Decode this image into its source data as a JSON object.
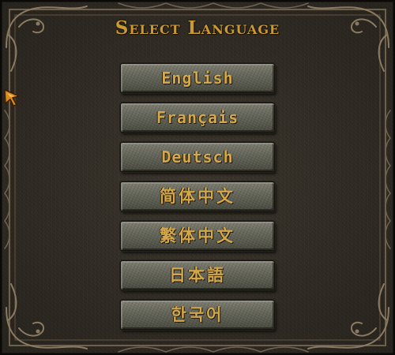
{
  "screen": {
    "title": "Select Language"
  },
  "languages": [
    {
      "label": "English"
    },
    {
      "label": "Français"
    },
    {
      "label": "Deutsch"
    },
    {
      "label": "简体中文"
    },
    {
      "label": "繁体中文"
    },
    {
      "label": "日本語"
    },
    {
      "label": "한국어"
    }
  ],
  "colors": {
    "title_gold": "#c99a32",
    "button_text_gold": "#d3a84a",
    "button_stone": "#66675b",
    "background_stone": "#3b352c",
    "frame_ornament": "#7a6a55"
  },
  "icons": {
    "cursor": "arrow-cursor-icon",
    "frame": "ornate-border"
  }
}
